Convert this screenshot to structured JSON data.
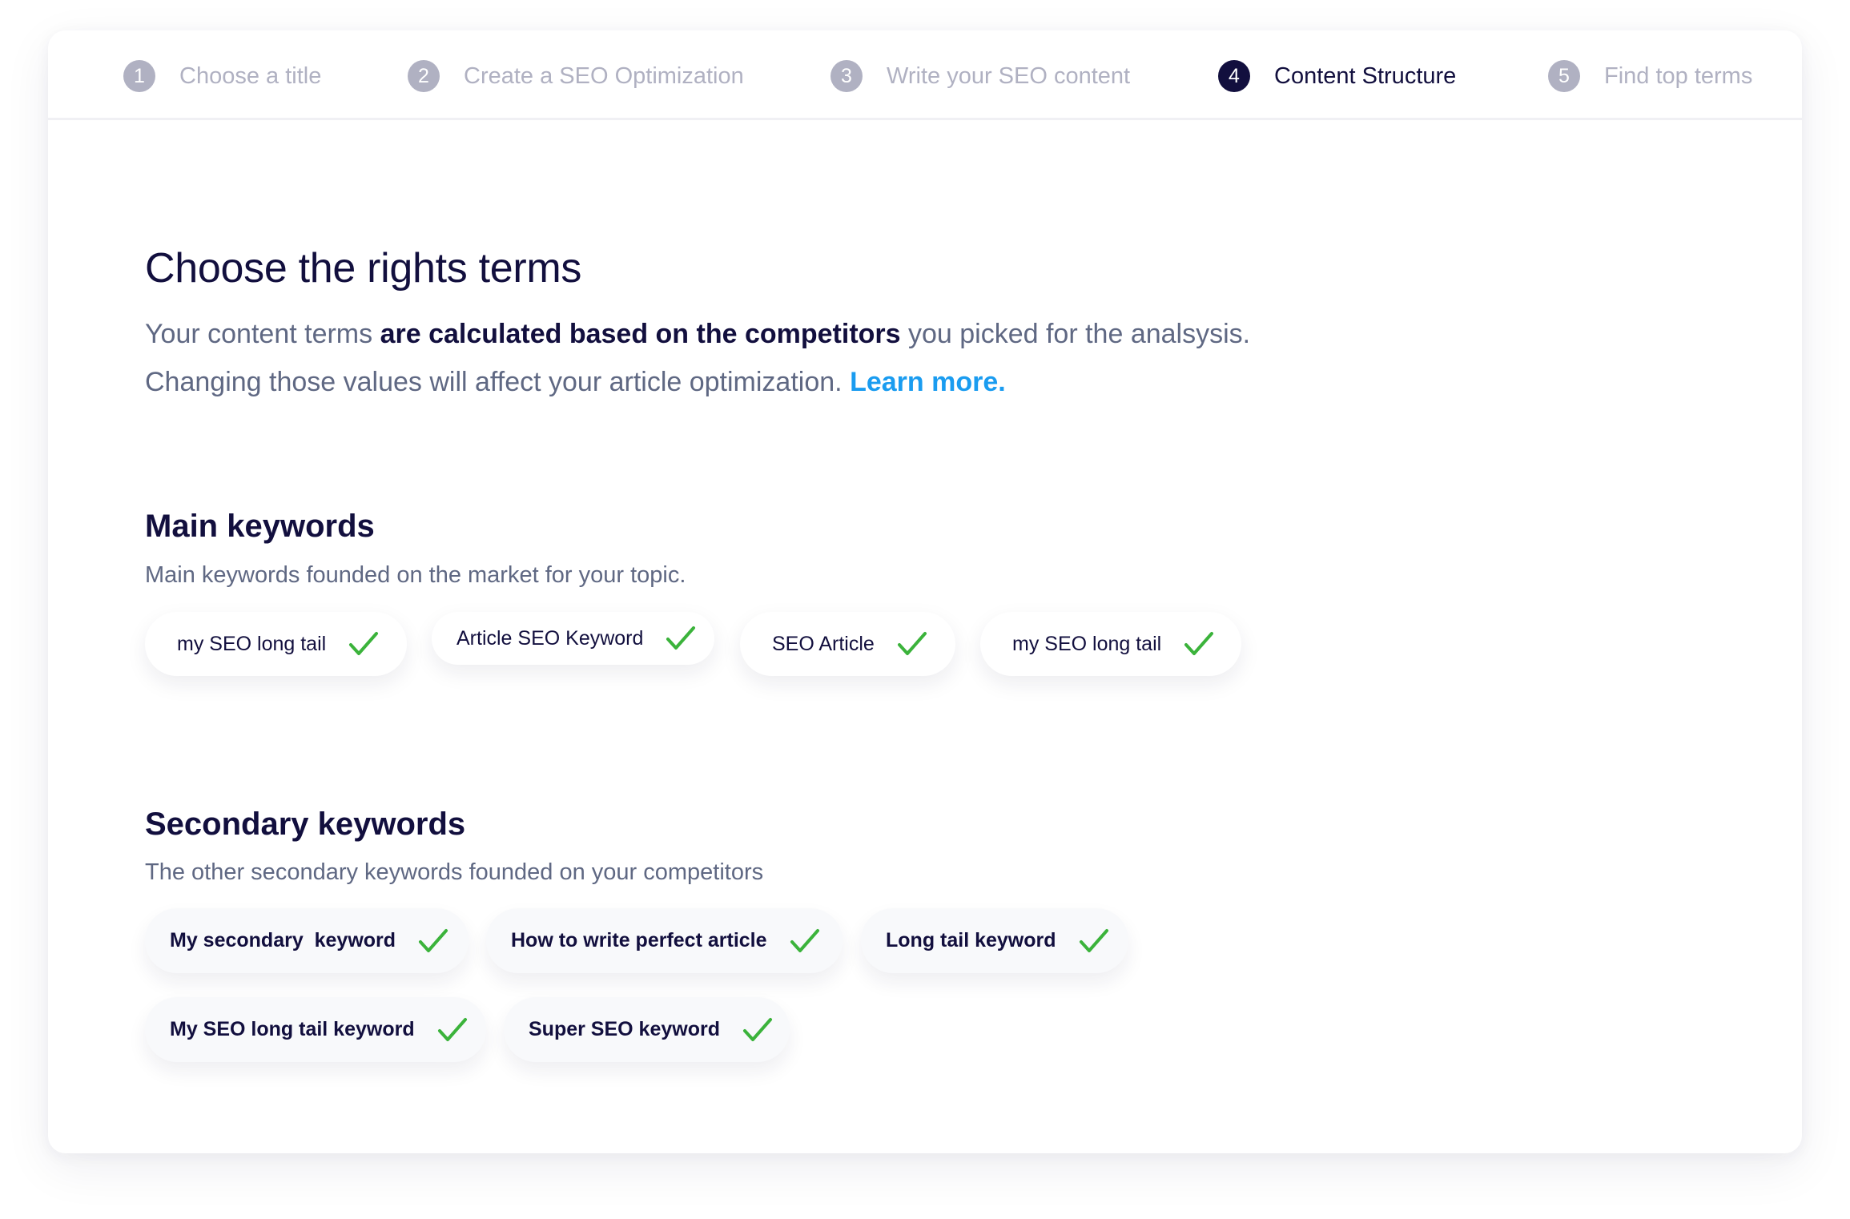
{
  "stepper": {
    "steps": [
      {
        "number": "1",
        "label": "Choose a title",
        "state": "inactive"
      },
      {
        "number": "2",
        "label": "Create a SEO Optimization",
        "state": "inactive"
      },
      {
        "number": "3",
        "label": "Write your SEO content",
        "state": "inactive"
      },
      {
        "number": "4",
        "label": "Content Structure",
        "state": "active"
      },
      {
        "number": "5",
        "label": "Find top terms",
        "state": "inactive"
      }
    ]
  },
  "page": {
    "title": "Choose the rights terms",
    "intro_line1_prefix": "Your content terms ",
    "intro_line1_bold": "are calculated based on the competitors",
    "intro_line1_suffix": " you picked for the analsysis.",
    "intro_line2": "Changing those values will affect your article optimization. ",
    "learn_more_link": "Learn more."
  },
  "main_keywords": {
    "title": "Main keywords",
    "subtitle": "Main keywords founded on the market for your topic.",
    "chips": [
      {
        "label": "my SEO long tail",
        "selected": true,
        "icon": "check-icon"
      },
      {
        "label": "Article SEO Keyword",
        "selected": true,
        "icon": "check-icon"
      },
      {
        "label": "SEO Article",
        "selected": true,
        "icon": "check-icon"
      },
      {
        "label": "my SEO long tail",
        "selected": true,
        "icon": "check-icon"
      }
    ]
  },
  "secondary_keywords": {
    "title": "Secondary keywords",
    "subtitle": "The other secondary keywords founded on your competitors",
    "chips": [
      {
        "label": "My secondary  keyword",
        "selected": true,
        "icon": "check-icon"
      },
      {
        "label": "How to write perfect article",
        "selected": true,
        "icon": "check-icon"
      },
      {
        "label": "Long tail keyword",
        "selected": true,
        "icon": "check-icon"
      },
      {
        "label": "My SEO long tail keyword",
        "selected": true,
        "icon": "check-icon"
      },
      {
        "label": "Super SEO keyword",
        "selected": true,
        "icon": "check-icon"
      }
    ]
  },
  "colors": {
    "primary_text": "#120f3e",
    "secondary_text": "#5f6883",
    "inactive_step": "#b0b1c2",
    "link": "#1a9cf0",
    "check": "#3bb33b"
  }
}
